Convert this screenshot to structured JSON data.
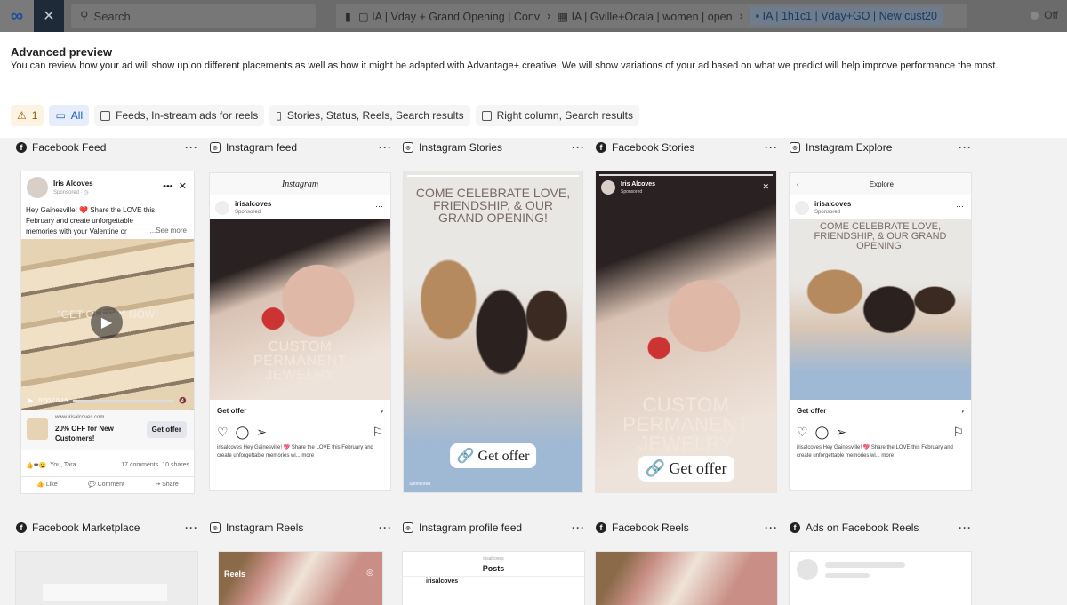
{
  "topbar": {
    "search_placeholder": "Search",
    "crumbs": [
      "IA | Vday + Grand Opening | Conv",
      "IA | Gville+Ocala | women | open",
      "IA | 1h1c1 | Vday+GO | New cust20"
    ],
    "status": "Off"
  },
  "header": {
    "title": "Advanced preview",
    "description": "You can review how your ad will show up on different placements as well as how it might be adapted with Advantage+ creative. We will show variations of your ad based on what we predict will help improve performance the most."
  },
  "filters": {
    "warning_count": "1",
    "all": "All",
    "feeds": "Feeds, In-stream ads for reels",
    "stories": "Stories, Status, Reels, Search results",
    "right": "Right column, Search results"
  },
  "placements": {
    "row1": [
      "Facebook Feed",
      "Instagram feed",
      "Instagram Stories",
      "Facebook Stories",
      "Instagram Explore"
    ],
    "row2": [
      "Facebook Marketplace",
      "Instagram Reels",
      "Instagram profile feed",
      "Facebook Reels",
      "Ads on Facebook Reels"
    ]
  },
  "fbfeed": {
    "page": "Iris Alcoves",
    "sponsored": "Sponsored · ◷",
    "text": "Hey Gainesville! ❤️ Share the LOVE this February and create unforgettable memories with your Valentine or",
    "see_more": "...See more",
    "video_text": "\"GET OFFER\" NOW!",
    "time": "0:00 / 0:15",
    "url": "www.irisalcoves.com",
    "headline": "20% OFF for New Customers!",
    "cta": "Get offer",
    "reactions": "You, Tara ...",
    "comments": "17 comments",
    "shares": "10 shares",
    "like": "Like",
    "comment": "Comment",
    "share": "Share"
  },
  "igfeed": {
    "brand": "Instagram",
    "handle": "irisalcoves",
    "sponsored": "Sponsored",
    "overlay": "CUSTOM PERMANENT JEWELRY",
    "cta": "Get offer",
    "caption": "irisalcoves Hey Gainesville! 💖 Share the LOVE this February and create unforgettable memories wi... more"
  },
  "igstories": {
    "headline": "COME CELEBRATE LOVE, FRIENDSHIP, & OUR GRAND OPENING!",
    "cta": "Get offer",
    "sponsored": "Sponsored"
  },
  "fbstories": {
    "page": "Iris Alcoves",
    "sponsored": "Sponsored",
    "overlay": "CUSTOM PERMANENT JEWELRY",
    "cta": "Get offer"
  },
  "igexplore": {
    "title": "Explore",
    "handle": "irisalcoves",
    "sponsored": "Sponsored",
    "headline": "COME CELEBRATE LOVE, FRIENDSHIP, & OUR GRAND OPENING!",
    "cta": "Get offer",
    "caption": "irisalcoves Hey Gainesville! 💖 Share the LOVE this February and create unforgettable memories wi... more"
  },
  "row2": {
    "reels_label": "Reels",
    "profile_handle": "irisalcoves",
    "posts": "Posts",
    "profile_post_handle": "irisalcoves"
  }
}
